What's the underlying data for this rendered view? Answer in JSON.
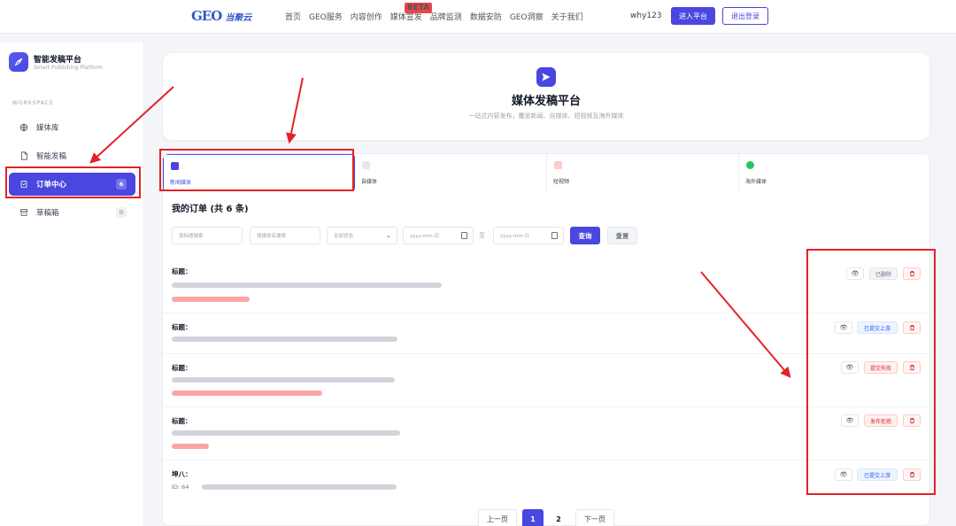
{
  "nav": {
    "logo_geo": "GEO",
    "logo_text": "当聚云",
    "links": [
      "首页",
      "GEO服务",
      "内容创作",
      "媒体宣发",
      "品牌监测",
      "数据安防",
      "GEO洞察",
      "关于我们"
    ],
    "active_link": "媒体宣发",
    "beta_badge": "BETA",
    "username": "why123",
    "enter_label": "进入平台",
    "logout_label": "退出登录"
  },
  "sidebar": {
    "brand_title": "智能发稿平台",
    "brand_sub": "Smart Publishing Platform",
    "section": "WORKSPACE",
    "items": [
      {
        "label": "媒体库",
        "icon": "globe-icon",
        "badge": ""
      },
      {
        "label": "智能发稿",
        "icon": "document-icon",
        "badge": ""
      },
      {
        "label": "订单中心",
        "icon": "clipboard-icon",
        "badge": "6"
      },
      {
        "label": "草稿箱",
        "icon": "archive-icon",
        "badge": "0"
      }
    ]
  },
  "hero": {
    "title": "媒体发稿平台",
    "subtitle": "一站式内容发布，覆盖新闻、自媒体、短视频及海外媒体",
    "icon": "send-icon"
  },
  "tabs": [
    {
      "label": "新闻媒体",
      "color": "#4a46e0"
    },
    {
      "label": "自媒体",
      "color": "#e5e7eb"
    },
    {
      "label": "短视频",
      "color": "#fca5a5"
    },
    {
      "label": "海外媒体",
      "color": "#22c55e"
    }
  ],
  "orders": {
    "title": "我的订单 (共 6 条)",
    "filters": {
      "order_search": "按标题搜索",
      "media_search": "按媒体名搜索",
      "status": "全部状态",
      "date_from": "yyyy-mm-日",
      "to": "至",
      "date_to": "yyyy-mm-日",
      "query": "查询",
      "reset": "重置"
    },
    "rows": [
      {
        "title": "标题：",
        "status": "已删除",
        "status_type": "gray"
      },
      {
        "title": "标题：",
        "status": "已提交上游",
        "status_type": "blue"
      },
      {
        "title": "标题：",
        "status": "提交失败",
        "status_type": "red"
      },
      {
        "title": "标题：",
        "status": "发布拒绝",
        "status_type": "red"
      },
      {
        "title": "坤八：",
        "status": "已提交上游",
        "status_type": "blue"
      }
    ],
    "row5_id": "ID: 64"
  },
  "pager": {
    "prev": "上一页",
    "pages": [
      "1",
      "2"
    ],
    "current": "1",
    "next": "下一页"
  },
  "colors": {
    "accent": "#4a46e0",
    "annotation": "#e32228"
  }
}
